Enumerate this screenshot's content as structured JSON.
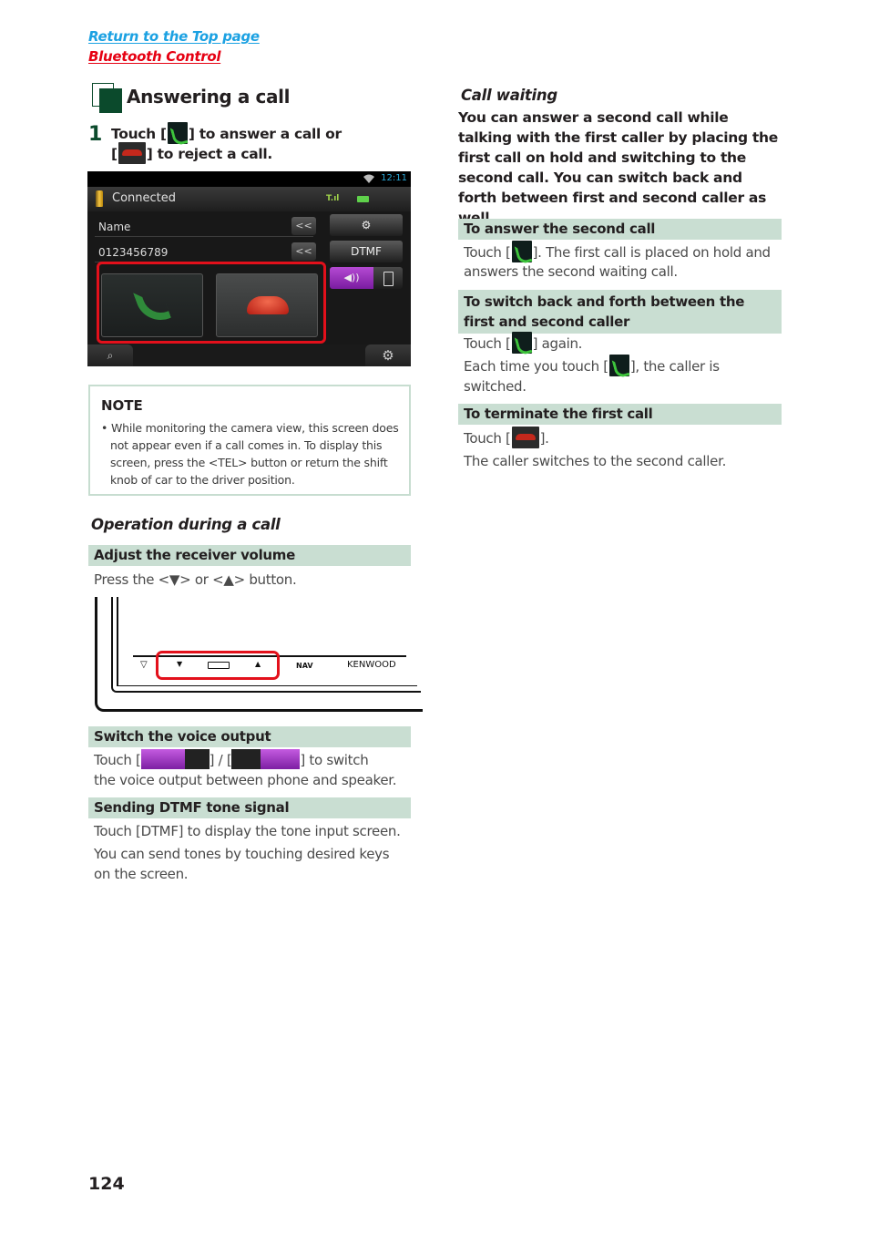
{
  "nav": {
    "return_top": "Return to the Top page",
    "bluetooth_control": "Bluetooth Control"
  },
  "colors": {
    "link_blue": "#1ba1e2",
    "link_red": "#e60012",
    "heading_green": "#0b4a2c",
    "bar_green": "#c9ded2",
    "highlight_red": "#e3101b",
    "speaker_purple": "#9b30c0"
  },
  "section": {
    "title": "Answering a call",
    "step_number": "1",
    "step_part1": "Touch [",
    "step_part2": "] to answer a call or",
    "step_part3": "[",
    "step_part4": "] to reject a call."
  },
  "screen": {
    "time": "12:11",
    "status": "Connected",
    "signal_label": "T.ıl",
    "name_label": "Name",
    "number": "0123456789",
    "back_glyph": "<<",
    "settings_glyph": "⚙",
    "dtmf_button": "DTMF",
    "speaker_glyph": "◀))",
    "search_glyph": "⌕",
    "gear_glyph": "⚙"
  },
  "note": {
    "title": "NOTE",
    "body": "• While monitoring the camera view, this screen does not appear even if a call comes in. To display this screen, press the <TEL> button or return the shift knob of car to the driver position."
  },
  "operation": {
    "title": "Operation during a call",
    "volume_head": "Adjust the receiver volume",
    "volume_text": "Press the <▼> or <▲> button.",
    "unit_labels": {
      "eject": "▽",
      "vol_down": "▼",
      "vol_up": "▲",
      "nav": "NAV",
      "brand": "KENWOOD"
    },
    "voice_head": "Switch the voice output",
    "voice_text1": "Touch [",
    "voice_text2": "] / [",
    "voice_text3": "] to switch",
    "voice_text4": "the voice output between phone and speaker.",
    "dtmf_head": "Sending DTMF tone signal",
    "dtmf_text1": "Touch [DTMF] to display the tone input screen.",
    "dtmf_text2": "You can send tones by touching desired keys on the screen."
  },
  "call_waiting": {
    "title": "Call waiting",
    "intro": "You can answer a second call while talking with the first caller by placing  the first call on hold and switching to the second call. You can switch back and forth between first and second caller as well.",
    "answer_head": "To answer the second call",
    "answer_text1": "Touch [",
    "answer_text2": "]. The first call is placed on hold and answers the second waiting call.",
    "switch_head": "To switch back and forth between the first and second caller",
    "switch_text1": "Touch [",
    "switch_text2": "] again.",
    "switch_text3": "Each time you touch [",
    "switch_text4": "], the caller is switched.",
    "terminate_head": "To terminate the first call",
    "terminate_text1": "Touch [",
    "terminate_text2": "].",
    "terminate_text3": "The caller switches to the second caller."
  },
  "page_number": "124"
}
